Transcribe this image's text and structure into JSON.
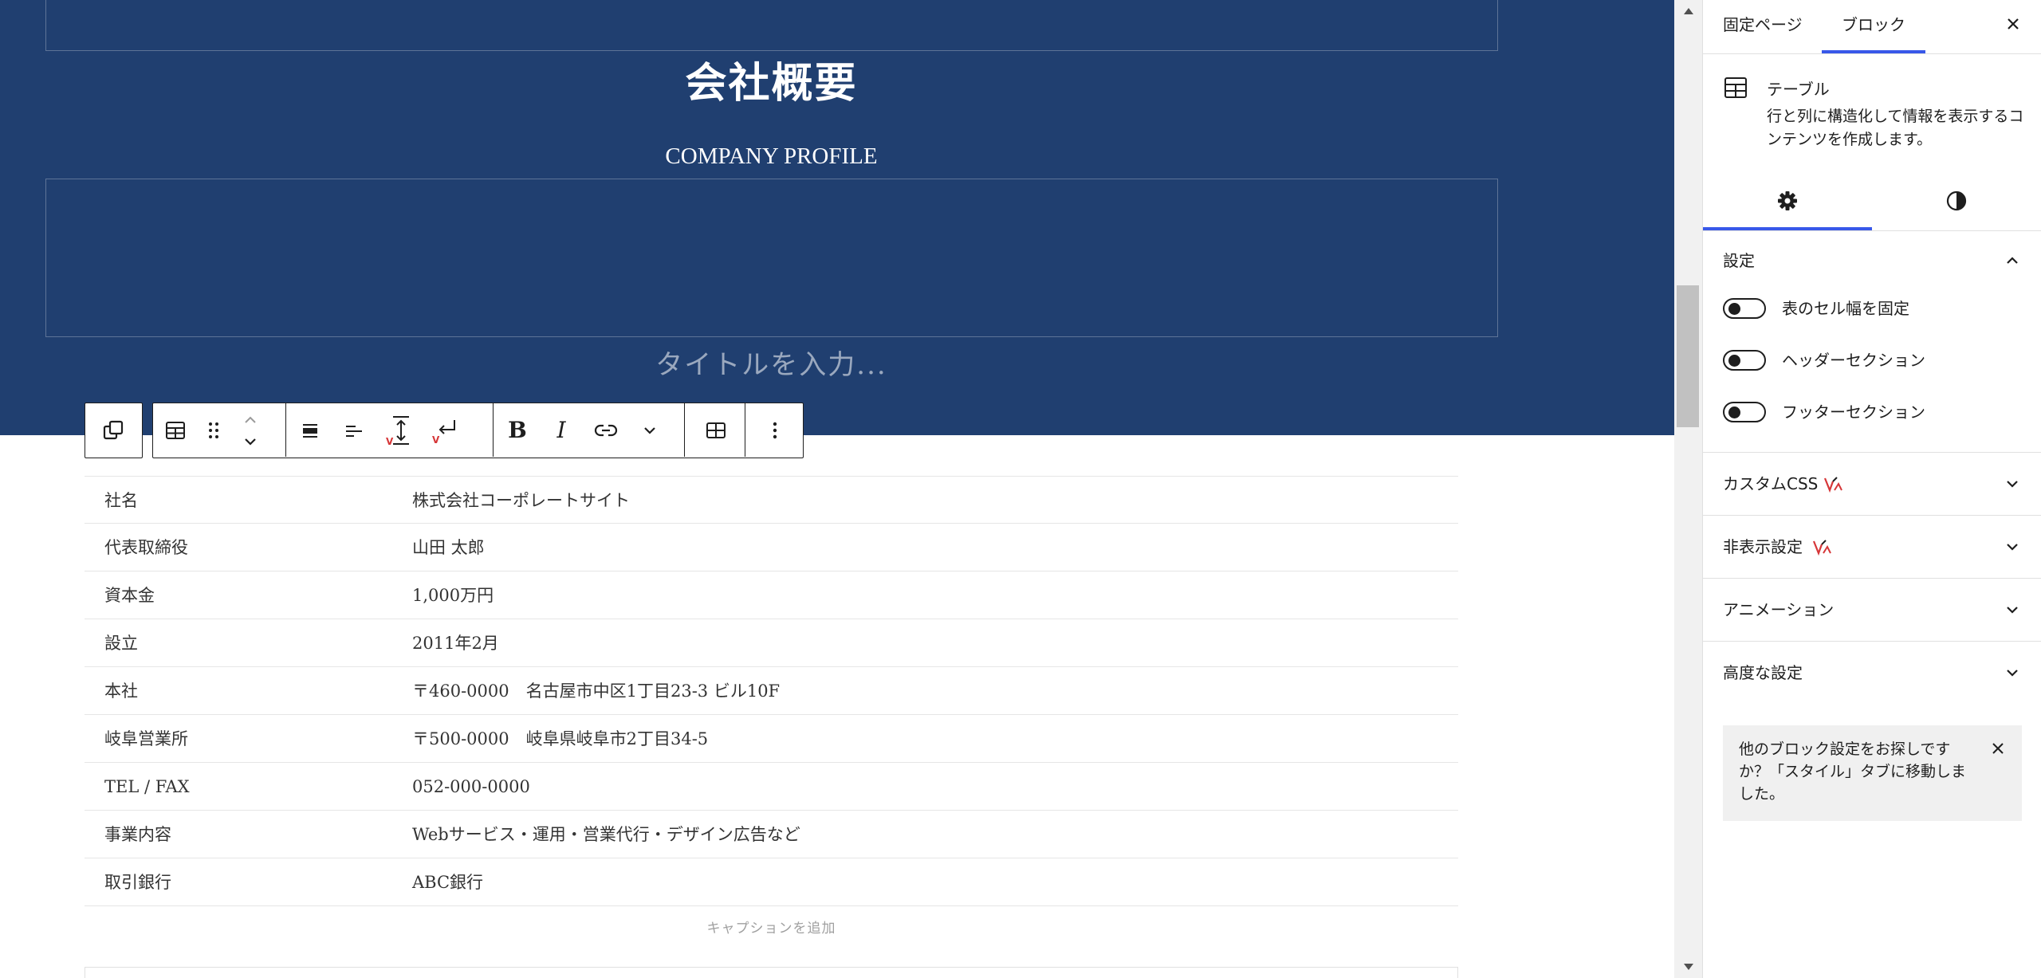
{
  "hero": {
    "title": "会社概要",
    "subtitle": "COMPANY PROFILE",
    "title_placeholder": "タイトルを入力..."
  },
  "toolbar": {
    "parent_icon": "select-parent-icon",
    "block_type_icon": "table-icon",
    "drag_icon": "drag-handle-icon",
    "move_up_icon": "chevron-up-icon",
    "move_down_icon": "chevron-down-icon",
    "align_icon": "align-wide-icon",
    "text_align_icon": "align-left-icon",
    "line_height_icon": "line-height-icon",
    "line_break_icon": "line-break-icon",
    "bold_label": "B",
    "italic_label": "I",
    "link_icon": "link-icon",
    "more_format_icon": "chevron-down-icon",
    "edit_table_icon": "table-edit-icon",
    "options_icon": "more-vertical-icon"
  },
  "table": {
    "rows": [
      {
        "label": "社名",
        "value": "株式会社コーポレートサイト"
      },
      {
        "label": "代表取締役",
        "value": "山田 太郎"
      },
      {
        "label": "資本金",
        "value": "1,000万円"
      },
      {
        "label": "設立",
        "value": "2011年2月"
      },
      {
        "label": "本社",
        "value": "〒460-0000　名古屋市中区1丁目23-3 ビル10F"
      },
      {
        "label": "岐阜営業所",
        "value": "〒500-0000　岐阜県岐阜市2丁目34-5"
      },
      {
        "label": "TEL / FAX",
        "value": "052-000-0000"
      },
      {
        "label": "事業内容",
        "value": "Webサービス・運用・営業代行・デザイン広告など"
      },
      {
        "label": "取引銀行",
        "value": "ABC銀行"
      }
    ],
    "caption_placeholder": "キャプションを追加"
  },
  "sidebar": {
    "tabs": {
      "page": "固定ページ",
      "block": "ブロック"
    },
    "block_name": "テーブル",
    "block_description": "行と列に構造化して情報を表示するコンテンツを作成します。",
    "settings_panel": {
      "title": "設定",
      "toggles": [
        {
          "label": "表のセル幅を固定",
          "checked": false
        },
        {
          "label": "ヘッダーセクション",
          "checked": false
        },
        {
          "label": "フッターセクション",
          "checked": false
        }
      ]
    },
    "panels": [
      {
        "label": "カスタムCSS"
      },
      {
        "label": "非表示設定"
      },
      {
        "label": "アニメーション"
      },
      {
        "label": "高度な設定"
      }
    ],
    "notice": "他のブロック設定をお探しですか？「スタイル」タブに移動しました。"
  },
  "colors": {
    "hero_bg": "#203f70",
    "accent": "#3858e9",
    "badge": "#d63638"
  }
}
